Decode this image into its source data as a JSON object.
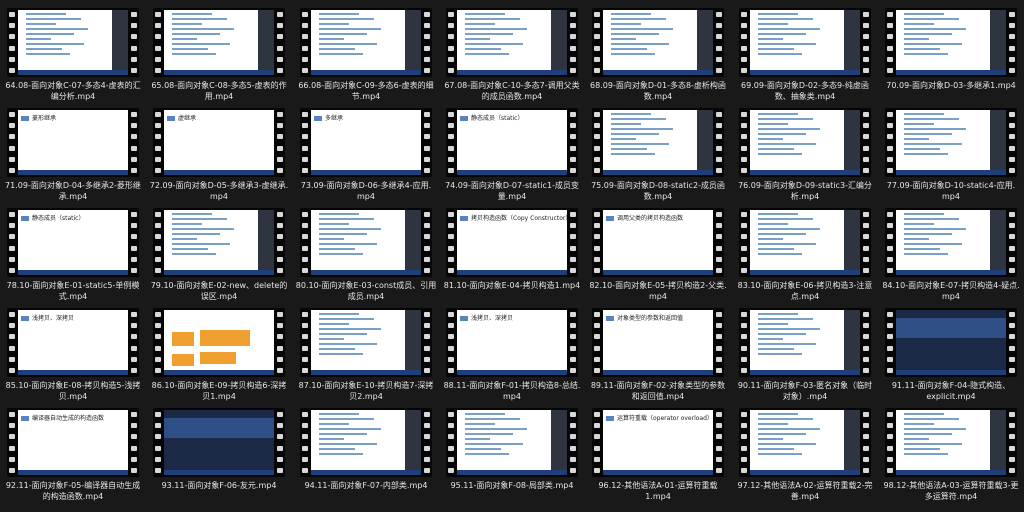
{
  "colors": {
    "background": "#191919",
    "caption_text": "#e6e6e6",
    "film_strip": "#050505",
    "perforation": "#d8d8d8"
  },
  "icons": {
    "video": "film-strip-video-thumbnail-icon"
  },
  "files": [
    {
      "name": "64.08-面向对象C-07-多态4-虚表的汇\n编分析.mp4",
      "preview": "code"
    },
    {
      "name": "65.08-面向对象C-08-多态5-虚表的作\n用.mp4",
      "preview": "code"
    },
    {
      "name": "66.08-面向对象C-09-多态6-虚表的细\n节.mp4",
      "preview": "code"
    },
    {
      "name": "67.08-面向对象C-10-多态7-调用父类\n的成员函数.mp4",
      "preview": "code"
    },
    {
      "name": "68.09-面向对象D-01-多态8-虚析构函\n数.mp4",
      "preview": "code"
    },
    {
      "name": "69.09-面向对象D-02-多态9-纯虚函\n数、抽象类.mp4",
      "preview": "code"
    },
    {
      "name": "70.09-面向对象D-03-多继承1.mp4",
      "preview": "code"
    },
    {
      "name": "71.09-面向对象D-04-多继承2-菱形继\n承.mp4",
      "preview": "slide",
      "heading": "菱形继承"
    },
    {
      "name": "72.09-面向对象D-05-多继承3-虚继承.\nmp4",
      "preview": "slide",
      "heading": "虚继承"
    },
    {
      "name": "73.09-面向对象D-06-多继承4-应用.\nmp4",
      "preview": "slide",
      "heading": "多继承"
    },
    {
      "name": "74.09-面向对象D-07-static1-成员变\n量.mp4",
      "preview": "slide",
      "heading": "静态成员（static）"
    },
    {
      "name": "75.09-面向对象D-08-static2-成员函\n数.mp4",
      "preview": "code"
    },
    {
      "name": "76.09-面向对象D-09-static3-汇编分\n析.mp4",
      "preview": "code"
    },
    {
      "name": "77.09-面向对象D-10-static4-应用.\nmp4",
      "preview": "code"
    },
    {
      "name": "78.10-面向对象E-01-static5-单例模\n式.mp4",
      "preview": "slide",
      "heading": "静态成员（static）"
    },
    {
      "name": "79.10-面向对象E-02-new、delete的\n误区.mp4",
      "preview": "code"
    },
    {
      "name": "80.10-面向对象E-03-const成员、引用\n成员.mp4",
      "preview": "code"
    },
    {
      "name": "81.10-面向对象E-04-拷贝构造1.mp4",
      "preview": "slide",
      "heading": "拷贝构造函数（Copy Constructor）"
    },
    {
      "name": "82.10-面向对象E-05-拷贝构造2-父类.\nmp4",
      "preview": "slide",
      "heading": "调用父类的拷贝构造函数"
    },
    {
      "name": "83.10-面向对象E-06-拷贝构造3-注意\n点.mp4",
      "preview": "code"
    },
    {
      "name": "84.10-面向对象E-07-拷贝构造4-疑点.\nmp4",
      "preview": "code"
    },
    {
      "name": "85.10-面向对象E-08-拷贝构造5-浅拷\n贝.mp4",
      "preview": "slide",
      "heading": "浅拷贝、深拷贝"
    },
    {
      "name": "86.10-面向对象E-09-拷贝构造6-深拷\n贝1.mp4",
      "preview": "diagram"
    },
    {
      "name": "87.10-面向对象E-10-拷贝构造7-深拷\n贝2.mp4",
      "preview": "code"
    },
    {
      "name": "88.11-面向对象F-01-拷贝构造8-总结.\nmp4",
      "preview": "slide",
      "heading": "浅拷贝、深拷贝"
    },
    {
      "name": "89.11-面向对象F-02-对象类型的参数\n和返回值.mp4",
      "preview": "slide",
      "heading": "对象类型的参数和返回值"
    },
    {
      "name": "90.11-面向对象F-03-匿名对象（临时\n对象）.mp4",
      "preview": "code"
    },
    {
      "name": "91.11-面向对象F-04-隐式构造、\nexplicit.mp4",
      "preview": "navy"
    },
    {
      "name": "92.11-面向对象F-05-编译器自动生成\n的构造函数.mp4",
      "preview": "slide",
      "heading": "编译器自动生成的构造函数"
    },
    {
      "name": "93.11-面向对象F-06-友元.mp4",
      "preview": "navy"
    },
    {
      "name": "94.11-面向对象F-07-内部类.mp4",
      "preview": "code"
    },
    {
      "name": "95.11-面向对象F-08-局部类.mp4",
      "preview": "code"
    },
    {
      "name": "96.12-其他语法A-01-运算符重载\n1.mp4",
      "preview": "slide",
      "heading": "运算符重载（operator overload）"
    },
    {
      "name": "97.12-其他语法A-02-运算符重载2-完\n善.mp4",
      "preview": "code"
    },
    {
      "name": "98.12-其他语法A-03-运算符重载3-更\n多运算符.mp4",
      "preview": "code"
    }
  ]
}
